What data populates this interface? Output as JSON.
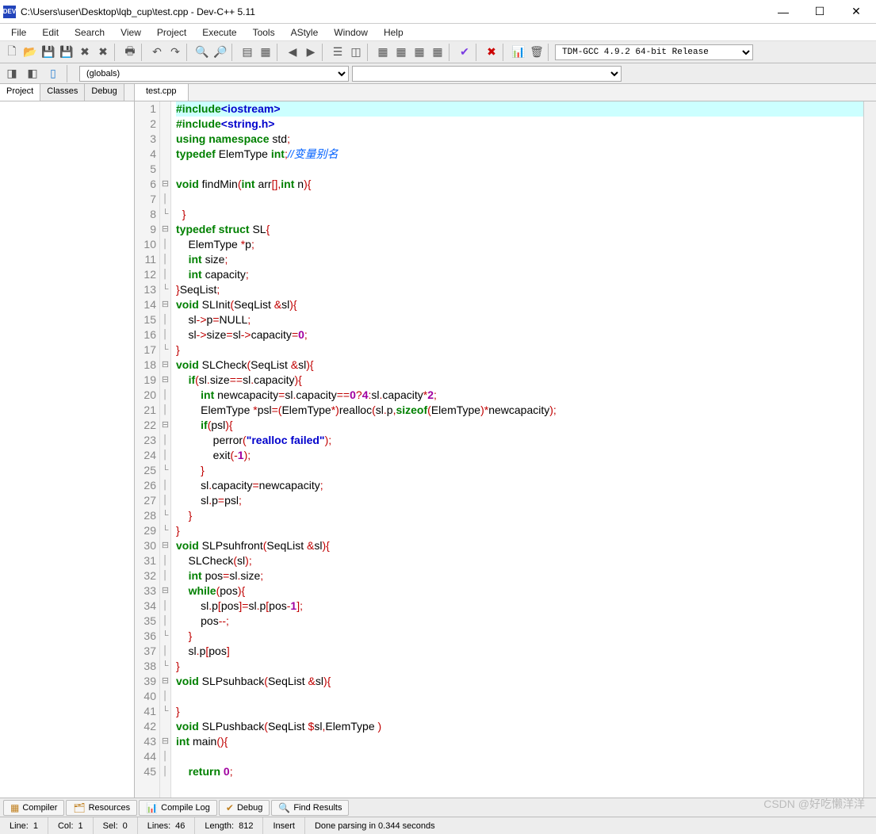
{
  "title": "C:\\Users\\user\\Desktop\\lqb_cup\\test.cpp - Dev-C++ 5.11",
  "app_icon": "DEV",
  "win": {
    "min": "—",
    "max": "☐",
    "close": "✕"
  },
  "menu": [
    "File",
    "Edit",
    "Search",
    "View",
    "Project",
    "Execute",
    "Tools",
    "AStyle",
    "Window",
    "Help"
  ],
  "compiler": "TDM-GCC 4.9.2 64-bit Release",
  "globals": "(globals)",
  "side_tabs": [
    "Project",
    "Classes",
    "Debug"
  ],
  "file_tab": "test.cpp",
  "bottom_tabs": [
    {
      "icon": "▦",
      "label": "Compiler"
    },
    {
      "icon": "🗂",
      "label": "Resources"
    },
    {
      "icon": "📊",
      "label": "Compile Log"
    },
    {
      "icon": "✔",
      "label": "Debug"
    },
    {
      "icon": "🔍",
      "label": "Find Results"
    }
  ],
  "statusbar": {
    "line_label": "Line:",
    "line_val": "1",
    "col_label": "Col:",
    "col_val": "1",
    "sel_label": "Sel:",
    "sel_val": "0",
    "lines_label": "Lines:",
    "lines_val": "46",
    "len_label": "Length:",
    "len_val": "812",
    "mode": "Insert",
    "parse": "Done parsing in 0.344 seconds"
  },
  "watermark": "CSDN @好吃懒洋洋",
  "code": {
    "lines": [
      {
        "n": 1,
        "fold": "",
        "hl": true,
        "tokens": [
          [
            "kw",
            "#include"
          ],
          [
            "strb",
            "<iostream>"
          ]
        ]
      },
      {
        "n": 2,
        "fold": "",
        "tokens": [
          [
            "kw",
            "#include"
          ],
          [
            "strb",
            "<string.h>"
          ]
        ]
      },
      {
        "n": 3,
        "fold": "",
        "tokens": [
          [
            "kw",
            "using namespace "
          ],
          [
            "id",
            "std"
          ],
          [
            "op",
            ";"
          ]
        ]
      },
      {
        "n": 4,
        "fold": "",
        "tokens": [
          [
            "kw",
            "typedef "
          ],
          [
            "id",
            "ElemType "
          ],
          [
            "kw",
            "int"
          ],
          [
            "op",
            ";"
          ],
          [
            "cm",
            "//变量别名"
          ]
        ]
      },
      {
        "n": 5,
        "fold": "",
        "tokens": [
          [
            "id",
            ""
          ]
        ]
      },
      {
        "n": 6,
        "fold": "⊟",
        "tokens": [
          [
            "kw",
            "void "
          ],
          [
            "id",
            "findMin"
          ],
          [
            "op",
            "("
          ],
          [
            "kw",
            "int "
          ],
          [
            "id",
            "arr"
          ],
          [
            "op",
            "[],"
          ],
          [
            "kw",
            "int "
          ],
          [
            "id",
            "n"
          ],
          [
            "op",
            "){"
          ]
        ]
      },
      {
        "n": 7,
        "fold": "│",
        "tokens": [
          [
            "id",
            "\t"
          ]
        ]
      },
      {
        "n": 8,
        "fold": "└",
        "tokens": [
          [
            "id",
            "  "
          ],
          [
            "op",
            "}"
          ]
        ]
      },
      {
        "n": 9,
        "fold": "⊟",
        "tokens": [
          [
            "kw",
            "typedef struct "
          ],
          [
            "id",
            "SL"
          ],
          [
            "op",
            "{"
          ]
        ]
      },
      {
        "n": 10,
        "fold": "│",
        "tokens": [
          [
            "id",
            "\tElemType "
          ],
          [
            "op",
            "*"
          ],
          [
            "id",
            "p"
          ],
          [
            "op",
            ";"
          ]
        ]
      },
      {
        "n": 11,
        "fold": "│",
        "tokens": [
          [
            "id",
            "\t"
          ],
          [
            "kw",
            "int "
          ],
          [
            "id",
            "size"
          ],
          [
            "op",
            ";"
          ]
        ]
      },
      {
        "n": 12,
        "fold": "│",
        "tokens": [
          [
            "id",
            "\t"
          ],
          [
            "kw",
            "int "
          ],
          [
            "id",
            "capacity"
          ],
          [
            "op",
            ";"
          ]
        ]
      },
      {
        "n": 13,
        "fold": "└",
        "tokens": [
          [
            "op",
            "}"
          ],
          [
            "id",
            "SeqList"
          ],
          [
            "op",
            ";"
          ]
        ]
      },
      {
        "n": 14,
        "fold": "⊟",
        "tokens": [
          [
            "kw",
            "void "
          ],
          [
            "id",
            "SLInit"
          ],
          [
            "op",
            "("
          ],
          [
            "id",
            "SeqList "
          ],
          [
            "op",
            "&"
          ],
          [
            "id",
            "sl"
          ],
          [
            "op",
            "){"
          ]
        ]
      },
      {
        "n": 15,
        "fold": "│",
        "tokens": [
          [
            "id",
            "\tsl"
          ],
          [
            "op",
            "->"
          ],
          [
            "id",
            "p"
          ],
          [
            "op",
            "="
          ],
          [
            "id",
            "NULL"
          ],
          [
            "op",
            ";"
          ]
        ]
      },
      {
        "n": 16,
        "fold": "│",
        "tokens": [
          [
            "id",
            "\tsl"
          ],
          [
            "op",
            "->"
          ],
          [
            "id",
            "size"
          ],
          [
            "op",
            "="
          ],
          [
            "id",
            "sl"
          ],
          [
            "op",
            "->"
          ],
          [
            "id",
            "capacity"
          ],
          [
            "op",
            "="
          ],
          [
            "numb",
            "0"
          ],
          [
            "op",
            ";"
          ]
        ]
      },
      {
        "n": 17,
        "fold": "└",
        "tokens": [
          [
            "op",
            "}"
          ]
        ]
      },
      {
        "n": 18,
        "fold": "⊟",
        "tokens": [
          [
            "kw",
            "void "
          ],
          [
            "id",
            "SLCheck"
          ],
          [
            "op",
            "("
          ],
          [
            "id",
            "SeqList "
          ],
          [
            "op",
            "&"
          ],
          [
            "id",
            "sl"
          ],
          [
            "op",
            "){"
          ]
        ]
      },
      {
        "n": 19,
        "fold": "⊟",
        "tokens": [
          [
            "id",
            "\t"
          ],
          [
            "kw",
            "if"
          ],
          [
            "op",
            "("
          ],
          [
            "id",
            "sl"
          ],
          [
            "op",
            "."
          ],
          [
            "id",
            "size"
          ],
          [
            "op",
            "=="
          ],
          [
            "id",
            "sl"
          ],
          [
            "op",
            "."
          ],
          [
            "id",
            "capacity"
          ],
          [
            "op",
            "){"
          ]
        ]
      },
      {
        "n": 20,
        "fold": "│",
        "tokens": [
          [
            "id",
            "\t\t"
          ],
          [
            "kw",
            "int "
          ],
          [
            "id",
            "newcapacity"
          ],
          [
            "op",
            "="
          ],
          [
            "id",
            "sl"
          ],
          [
            "op",
            "."
          ],
          [
            "id",
            "capacity"
          ],
          [
            "op",
            "=="
          ],
          [
            "numb",
            "0"
          ],
          [
            "op",
            "?"
          ],
          [
            "numb",
            "4"
          ],
          [
            "op",
            ":"
          ],
          [
            "id",
            "sl"
          ],
          [
            "op",
            "."
          ],
          [
            "id",
            "capacity"
          ],
          [
            "op",
            "*"
          ],
          [
            "numb",
            "2"
          ],
          [
            "op",
            ";"
          ]
        ]
      },
      {
        "n": 21,
        "fold": "│",
        "tokens": [
          [
            "id",
            "\t\tElemType "
          ],
          [
            "op",
            "*"
          ],
          [
            "id",
            "psl"
          ],
          [
            "op",
            "=("
          ],
          [
            "id",
            "ElemType"
          ],
          [
            "op",
            "*)"
          ],
          [
            "id",
            "realloc"
          ],
          [
            "op",
            "("
          ],
          [
            "id",
            "sl"
          ],
          [
            "op",
            "."
          ],
          [
            "id",
            "p"
          ],
          [
            "op",
            ","
          ],
          [
            "kw",
            "sizeof"
          ],
          [
            "op",
            "("
          ],
          [
            "id",
            "ElemType"
          ],
          [
            "op",
            ")*"
          ],
          [
            "id",
            "newcapacity"
          ],
          [
            "op",
            ");"
          ]
        ]
      },
      {
        "n": 22,
        "fold": "⊟",
        "tokens": [
          [
            "id",
            "\t\t"
          ],
          [
            "kw",
            "if"
          ],
          [
            "op",
            "("
          ],
          [
            "id",
            "psl"
          ],
          [
            "op",
            "){"
          ]
        ]
      },
      {
        "n": 23,
        "fold": "│",
        "tokens": [
          [
            "id",
            "\t\t\tperror"
          ],
          [
            "op",
            "("
          ],
          [
            "strb",
            "\"realloc failed\""
          ],
          [
            "op",
            ");"
          ]
        ]
      },
      {
        "n": 24,
        "fold": "│",
        "tokens": [
          [
            "id",
            "\t\t\texit"
          ],
          [
            "op",
            "(-"
          ],
          [
            "numb",
            "1"
          ],
          [
            "op",
            ");"
          ]
        ]
      },
      {
        "n": 25,
        "fold": "└",
        "tokens": [
          [
            "id",
            "\t\t"
          ],
          [
            "op",
            "}"
          ]
        ]
      },
      {
        "n": 26,
        "fold": "│",
        "tokens": [
          [
            "id",
            "\t\tsl"
          ],
          [
            "op",
            "."
          ],
          [
            "id",
            "capacity"
          ],
          [
            "op",
            "="
          ],
          [
            "id",
            "newcapacity"
          ],
          [
            "op",
            ";"
          ]
        ]
      },
      {
        "n": 27,
        "fold": "│",
        "tokens": [
          [
            "id",
            "\t\tsl"
          ],
          [
            "op",
            "."
          ],
          [
            "id",
            "p"
          ],
          [
            "op",
            "="
          ],
          [
            "id",
            "psl"
          ],
          [
            "op",
            ";"
          ]
        ]
      },
      {
        "n": 28,
        "fold": "└",
        "tokens": [
          [
            "id",
            "\t"
          ],
          [
            "op",
            "}"
          ]
        ]
      },
      {
        "n": 29,
        "fold": "└",
        "tokens": [
          [
            "op",
            "}"
          ]
        ]
      },
      {
        "n": 30,
        "fold": "⊟",
        "tokens": [
          [
            "kw",
            "void "
          ],
          [
            "id",
            "SLPsuhfront"
          ],
          [
            "op",
            "("
          ],
          [
            "id",
            "SeqList "
          ],
          [
            "op",
            "&"
          ],
          [
            "id",
            "sl"
          ],
          [
            "op",
            "){"
          ]
        ]
      },
      {
        "n": 31,
        "fold": "│",
        "tokens": [
          [
            "id",
            "\tSLCheck"
          ],
          [
            "op",
            "("
          ],
          [
            "id",
            "sl"
          ],
          [
            "op",
            ");"
          ]
        ]
      },
      {
        "n": 32,
        "fold": "│",
        "tokens": [
          [
            "id",
            "\t"
          ],
          [
            "kw",
            "int "
          ],
          [
            "id",
            "pos"
          ],
          [
            "op",
            "="
          ],
          [
            "id",
            "sl"
          ],
          [
            "op",
            "."
          ],
          [
            "id",
            "size"
          ],
          [
            "op",
            ";"
          ]
        ]
      },
      {
        "n": 33,
        "fold": "⊟",
        "tokens": [
          [
            "id",
            "\t"
          ],
          [
            "kw",
            "while"
          ],
          [
            "op",
            "("
          ],
          [
            "id",
            "pos"
          ],
          [
            "op",
            "){"
          ]
        ]
      },
      {
        "n": 34,
        "fold": "│",
        "tokens": [
          [
            "id",
            "\t\tsl"
          ],
          [
            "op",
            "."
          ],
          [
            "id",
            "p"
          ],
          [
            "op",
            "["
          ],
          [
            "id",
            "pos"
          ],
          [
            "op",
            "]="
          ],
          [
            "id",
            "sl"
          ],
          [
            "op",
            "."
          ],
          [
            "id",
            "p"
          ],
          [
            "op",
            "["
          ],
          [
            "id",
            "pos"
          ],
          [
            "op",
            "-"
          ],
          [
            "numb",
            "1"
          ],
          [
            "op",
            "];"
          ]
        ]
      },
      {
        "n": 35,
        "fold": "│",
        "tokens": [
          [
            "id",
            "\t\tpos"
          ],
          [
            "op",
            "--;"
          ]
        ]
      },
      {
        "n": 36,
        "fold": "└",
        "tokens": [
          [
            "id",
            "\t"
          ],
          [
            "op",
            "}"
          ]
        ]
      },
      {
        "n": 37,
        "fold": "│",
        "tokens": [
          [
            "id",
            "\tsl"
          ],
          [
            "op",
            "."
          ],
          [
            "id",
            "p"
          ],
          [
            "op",
            "["
          ],
          [
            "id",
            "pos"
          ],
          [
            "op",
            "]"
          ]
        ]
      },
      {
        "n": 38,
        "fold": "└",
        "tokens": [
          [
            "op",
            "}"
          ]
        ]
      },
      {
        "n": 39,
        "fold": "⊟",
        "tokens": [
          [
            "kw",
            "void "
          ],
          [
            "id",
            "SLPsuhback"
          ],
          [
            "op",
            "("
          ],
          [
            "id",
            "SeqList "
          ],
          [
            "op",
            "&"
          ],
          [
            "id",
            "sl"
          ],
          [
            "op",
            "){"
          ]
        ]
      },
      {
        "n": 40,
        "fold": "│",
        "tokens": [
          [
            "id",
            "\t"
          ]
        ]
      },
      {
        "n": 41,
        "fold": "└",
        "tokens": [
          [
            "op",
            "}"
          ]
        ]
      },
      {
        "n": 42,
        "fold": "",
        "tokens": [
          [
            "kw",
            "void "
          ],
          [
            "id",
            "SLPushback"
          ],
          [
            "op",
            "("
          ],
          [
            "id",
            "SeqList "
          ],
          [
            "op",
            "$"
          ],
          [
            "id",
            "sl"
          ],
          [
            "op",
            ","
          ],
          [
            "id",
            "ElemType "
          ],
          [
            "op",
            ")"
          ]
        ]
      },
      {
        "n": 43,
        "fold": "⊟",
        "tokens": [
          [
            "kw",
            "int "
          ],
          [
            "id",
            "main"
          ],
          [
            "op",
            "(){"
          ]
        ]
      },
      {
        "n": 44,
        "fold": "│",
        "tokens": [
          [
            "id",
            "\t"
          ]
        ]
      },
      {
        "n": 45,
        "fold": "│",
        "tokens": [
          [
            "id",
            "\t"
          ],
          [
            "kw",
            "return "
          ],
          [
            "numb",
            "0"
          ],
          [
            "op",
            ";"
          ]
        ]
      }
    ]
  }
}
